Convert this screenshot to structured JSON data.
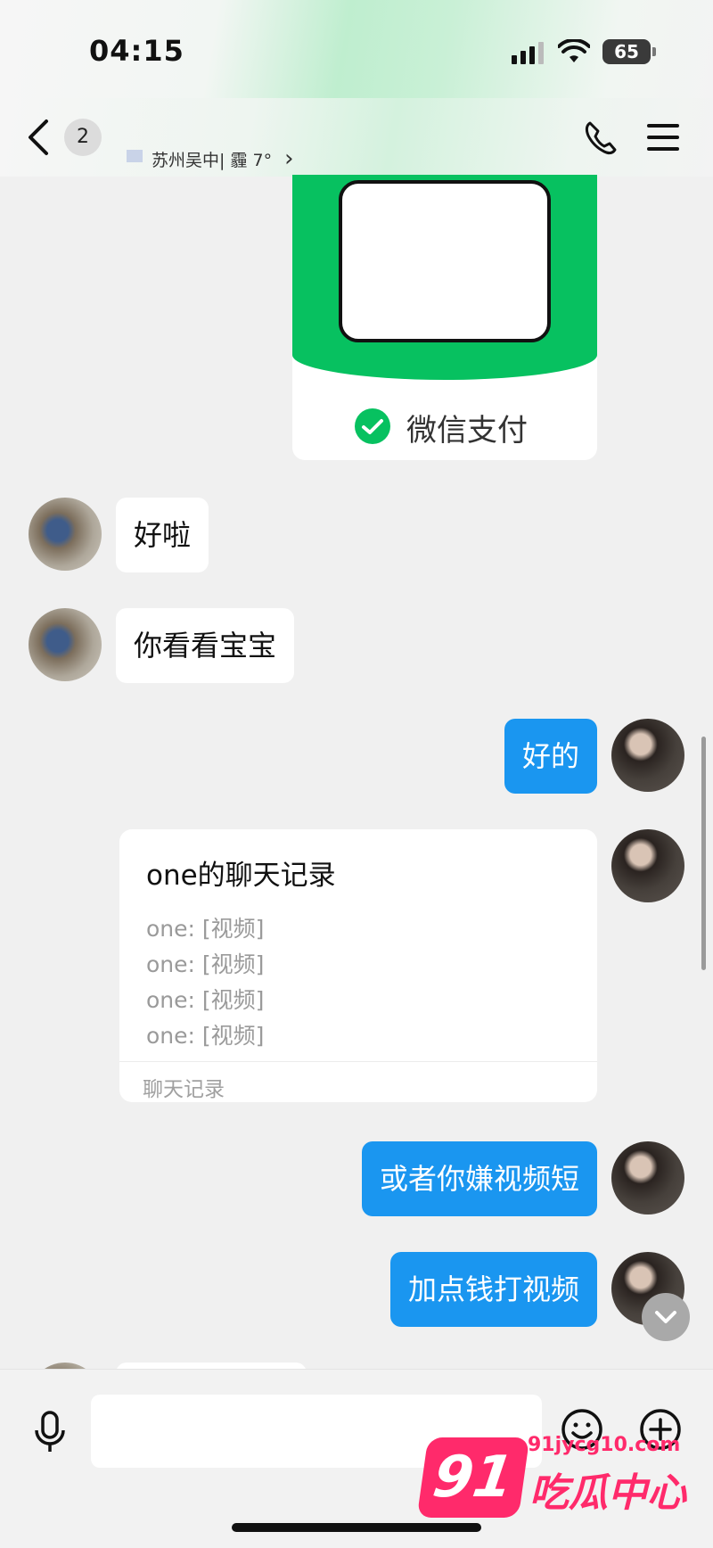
{
  "status": {
    "time": "04:15",
    "battery": "65"
  },
  "nav": {
    "unread_count": "2",
    "location": "苏州吴中| 霾 7°",
    "location_chevron": "›"
  },
  "payment_card": {
    "label": "微信支付"
  },
  "messages": [
    {
      "text": "好啦"
    },
    {
      "text": "你看看宝宝"
    },
    {
      "text": "好的"
    },
    {
      "text": "或者你嫌视频短"
    },
    {
      "text": "加点钱打视频"
    }
  ],
  "chat_record": {
    "title": "one的聊天记录",
    "lines": [
      "one: [视频]",
      "one: [视频]",
      "one: [视频]",
      "one: [视频]"
    ],
    "footer": "聊天记录"
  },
  "input": {
    "placeholder": ""
  },
  "watermark": {
    "number": "91",
    "url": "91jycg10.com",
    "brand": "吃瓜中心"
  },
  "colors": {
    "outgoing_bubble": "#1a96f0",
    "incoming_bubble": "#ffffff",
    "wechat_green": "#07c160",
    "watermark": "#ff2a6b"
  }
}
